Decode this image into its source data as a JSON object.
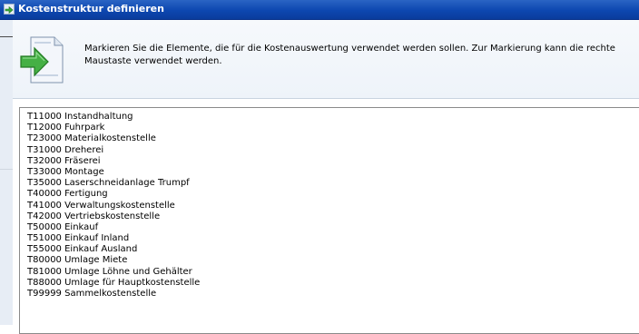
{
  "dialog": {
    "title": "Kostenstruktur definieren",
    "instruction": "Markieren Sie die Elemente, die für die Kostenauswertung verwendet werden sollen. Zur Markierung kann die rechte Maustaste verwendet werden.",
    "title_icon": "window-icon",
    "header_icon": "document-arrow-icon"
  },
  "colors": {
    "titlebar": "#0d47b0",
    "header_background": "#eef3f9",
    "arrow": "#3aa83a"
  },
  "cost_centers": [
    "T11000 Instandhaltung",
    "T12000 Fuhrpark",
    "T23000 Materialkostenstelle",
    "T31000 Dreherei",
    "T32000 Fräserei",
    "T33000 Montage",
    "T35000 Laserschneidanlage Trumpf",
    "T40000 Fertigung",
    "T41000 Verwaltungskostenstelle",
    "T42000 Vertriebskostenstelle",
    "T50000 Einkauf",
    "T51000 Einkauf Inland",
    "T55000 Einkauf Ausland",
    "T80000 Umlage Miete",
    "T81000 Umlage Löhne und Gehälter",
    "T88000 Umlage für Hauptkostenstelle",
    "T99999 Sammelkostenstelle"
  ]
}
